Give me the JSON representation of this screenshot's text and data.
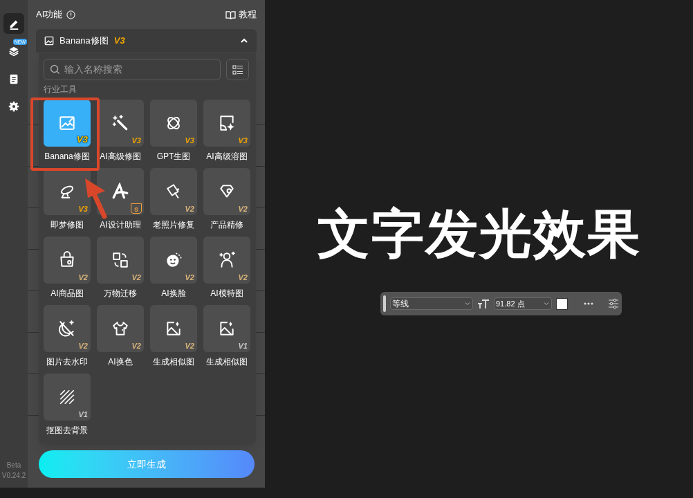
{
  "rail": {
    "items": [
      {
        "selected": true
      },
      {
        "selected": false,
        "badge": "NEW"
      },
      {
        "selected": false
      },
      {
        "selected": false
      }
    ],
    "version": [
      "Beta",
      "V0.24.2"
    ]
  },
  "panel": {
    "title": "AI功能",
    "tutorial": "教程",
    "dropdown": {
      "label": "Banana修图",
      "badge": "V3",
      "expanded": true
    }
  },
  "popup": {
    "search": {
      "placeholder": "输入名称搜索"
    },
    "section": "行业工具",
    "tools": [
      {
        "label": "Banana修图",
        "badge": "V3",
        "kind": "version",
        "color": "#ffc400",
        "selected": true
      },
      {
        "label": "AI高级修图",
        "badge": "V3",
        "kind": "version",
        "color": "#f0a500",
        "selected": false
      },
      {
        "label": "GPT生图",
        "badge": "V3",
        "kind": "version",
        "color": "#f0a500",
        "selected": false
      },
      {
        "label": "AI高级溶图",
        "badge": "V3",
        "kind": "version",
        "color": "#f0a500",
        "selected": false
      },
      {
        "label": "即梦修图",
        "badge": "V3",
        "kind": "version",
        "color": "#f0a500",
        "selected": false
      },
      {
        "label": "AI设计助理",
        "badge": "S",
        "kind": "crown",
        "color": "#f0a040",
        "selected": false
      },
      {
        "label": "老照片修复",
        "badge": "V2",
        "kind": "version",
        "color": "#d8b37a",
        "selected": false
      },
      {
        "label": "产品精修",
        "badge": "V2",
        "kind": "version",
        "color": "#d8b37a",
        "selected": false
      },
      {
        "label": "AI商品图",
        "badge": "V2",
        "kind": "version",
        "color": "#d8b37a",
        "selected": false
      },
      {
        "label": "万物迁移",
        "badge": "V2",
        "kind": "version",
        "color": "#d8b37a",
        "selected": false
      },
      {
        "label": "AI换脸",
        "badge": "V2",
        "kind": "version",
        "color": "#d8b37a",
        "selected": false
      },
      {
        "label": "AI模特图",
        "badge": "V2",
        "kind": "version",
        "color": "#d8b37a",
        "selected": false
      },
      {
        "label": "图片去水印",
        "badge": "V2",
        "kind": "version",
        "color": "#d8b37a",
        "selected": false
      },
      {
        "label": "AI换色",
        "badge": "V2",
        "kind": "version",
        "color": "#d8b37a",
        "selected": false
      },
      {
        "label": "生成相似图",
        "badge": "V2",
        "kind": "version",
        "color": "#d8b37a",
        "selected": false
      },
      {
        "label": "生成相似图",
        "badge": "V1",
        "kind": "version",
        "color": "#c8c8c8",
        "selected": false
      },
      {
        "label": "抠图去背景",
        "badge": "V1",
        "kind": "version",
        "color": "#c8c8c8",
        "selected": false
      }
    ]
  },
  "generate_button": "立即生成",
  "canvas": {
    "text": "文字发光效果"
  },
  "text_toolbar": {
    "font": "等线",
    "size": "91.82 点"
  }
}
